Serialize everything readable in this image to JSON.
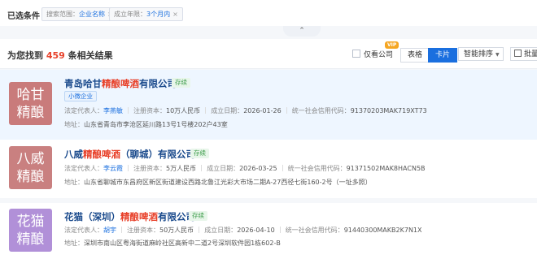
{
  "filters": {
    "title": "已选条件",
    "chips": [
      {
        "label": "搜索范围：",
        "value": "企业名称",
        "close": "×"
      },
      {
        "label": "成立年限：",
        "value": "3个月内",
        "close": "×"
      }
    ],
    "collapse_icon": "⌃"
  },
  "results": {
    "prefix": "为您找到",
    "count": "459",
    "suffix": "条相关结果",
    "only_company_label": "仅看公司",
    "vip_badge": "VIP",
    "view_table_label": "表格",
    "view_card_label": "卡片",
    "sort_label": "智能排序",
    "sort_chevron": "▼",
    "batch_label": "批量"
  },
  "colors": {
    "accent": "#1a6fdf",
    "highlight": "#e8412a",
    "status_green": "#3a9b47",
    "logo_1": "#c97b7b",
    "logo_2": "#c98080",
    "logo_3": "#b190d8"
  },
  "companies": [
    {
      "logo_line1": "哈甘",
      "logo_line2": "精酿",
      "name_pre": "青岛哈甘",
      "name_hit": "精酿啤酒",
      "name_post": "有限公司",
      "status": "存续",
      "tag": "小微企业",
      "legal_rep_label": "法定代表人：",
      "legal_rep": "李燕敏",
      "capital_label": "注册资本：",
      "capital": "10万人民币",
      "founded_label": "成立日期：",
      "founded": "2026-01-26",
      "credit_label": "统一社会信用代码：",
      "credit": "91370203MAK719XT73",
      "address_label": "地址：",
      "address": "山东省青岛市李沧区延川路13号1号楼202户43室"
    },
    {
      "logo_line1": "八威",
      "logo_line2": "精酿",
      "name_pre": "八威",
      "name_hit": "精酿啤酒",
      "name_post": "（聊城）有限公司",
      "status": "存续",
      "tag": "",
      "legal_rep_label": "法定代表人：",
      "legal_rep": "李云霞",
      "capital_label": "注册资本：",
      "capital": "5万人民币",
      "founded_label": "成立日期：",
      "founded": "2026-03-25",
      "credit_label": "统一社会信用代码：",
      "credit": "91371502MAK8HACN5B",
      "address_label": "地址：",
      "address": "山东省聊城市东昌府区新区街道建设西路北鲁江光彩大市场二期A-27西径七街160-2号（一址多照）"
    },
    {
      "logo_line1": "花猫",
      "logo_line2": "精酿",
      "name_pre": "花猫（深圳）",
      "name_hit": "精酿啤酒",
      "name_post": "有限公司",
      "status": "存续",
      "tag": "",
      "legal_rep_label": "法定代表人：",
      "legal_rep": "胡宇",
      "capital_label": "注册资本：",
      "capital": "50万人民币",
      "founded_label": "成立日期：",
      "founded": "2026-04-10",
      "credit_label": "统一社会信用代码：",
      "credit": "91440300MAKB2K7N1X",
      "address_label": "地址：",
      "address": "深圳市南山区粤海街道麻岭社区高新中二道2号深圳软件园1栋602-B"
    }
  ]
}
